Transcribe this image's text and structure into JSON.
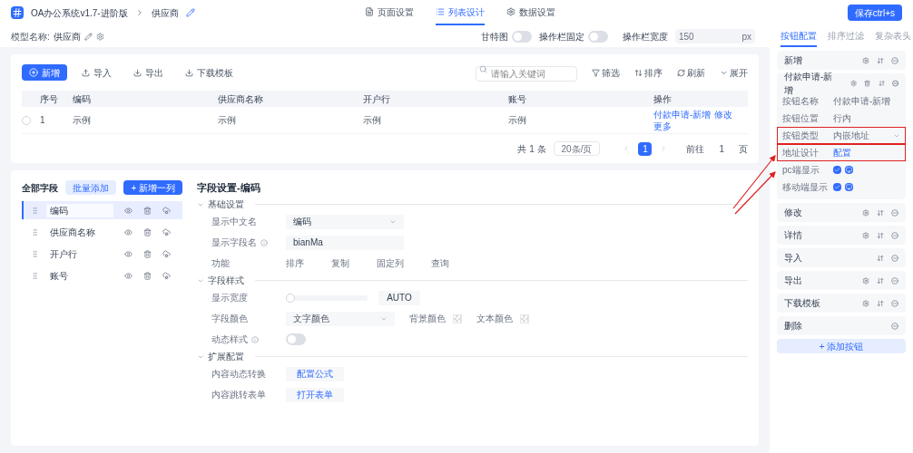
{
  "header": {
    "app": "OA办公系统v1.7-进阶版",
    "page": "供应商",
    "tabs": [
      {
        "label": "页面设置",
        "selected": false
      },
      {
        "label": "列表设计",
        "selected": true
      },
      {
        "label": "数据设置",
        "selected": false
      }
    ],
    "save_button": "保存ctrl+s"
  },
  "model": {
    "label": "模型名称:",
    "value": "供应商"
  },
  "list_options": {
    "toggles": [
      {
        "label": "甘特图",
        "on": false
      },
      {
        "label": "操作栏固定",
        "on": false
      }
    ],
    "width_label": "操作栏宽度",
    "width_value": "150",
    "width_unit": "px"
  },
  "side_tabs": [
    {
      "label": "按钮配置",
      "selected": true
    },
    {
      "label": "排序过滤",
      "selected": false
    },
    {
      "label": "复杂表头",
      "selected": false
    }
  ],
  "toolbar": {
    "buttons": [
      {
        "label": "新增",
        "kind": "primary"
      },
      {
        "label": "导入",
        "kind": "plain"
      },
      {
        "label": "导出",
        "kind": "plain"
      },
      {
        "label": "下载模板",
        "kind": "plain"
      }
    ],
    "search": {
      "placeholder": "请输入关键词"
    },
    "tools": [
      {
        "label": "筛选",
        "kind": "filter"
      },
      {
        "label": "排序",
        "kind": "sort"
      },
      {
        "label": "刷新",
        "kind": "refresh"
      },
      {
        "label": "展开",
        "kind": "expand"
      }
    ]
  },
  "table": {
    "columns": [
      "序号",
      "编码",
      "供应商名称",
      "开户行",
      "账号",
      "操作"
    ],
    "rows": [
      {
        "selected": false,
        "cells": [
          "1",
          "示例",
          "示例",
          "示例",
          "示例"
        ],
        "actions": [
          "付款申请-新增",
          "修改",
          "更多"
        ]
      }
    ]
  },
  "pagination": {
    "total": "共 1 条",
    "page_size": "20条/页",
    "pages": [
      {
        "label": "1",
        "selected": true
      }
    ],
    "goto_label": "前往",
    "goto_value": "1",
    "goto_suffix": "页"
  },
  "fields": {
    "title": "全部字段",
    "batch_button": "批量添加",
    "add_button": "+ 新增一列",
    "items": [
      {
        "name": "编码",
        "selected": true
      },
      {
        "name": "供应商名称",
        "selected": false
      },
      {
        "name": "开户行",
        "selected": false
      },
      {
        "name": "账号",
        "selected": false
      }
    ]
  },
  "settings": {
    "title": "字段设置-编码",
    "sections": [
      {
        "title": "基础设置",
        "expanded": true,
        "rows": [
          {
            "kind": "select",
            "label": "显示中文名",
            "info": false,
            "value": "编码"
          },
          {
            "kind": "input",
            "label": "显示字段名",
            "info": true,
            "value": "bianMa"
          },
          {
            "kind": "options",
            "label": "功能",
            "info": false,
            "options": [
              "排序",
              "复制",
              "固定列",
              "查询"
            ]
          }
        ]
      },
      {
        "title": "字段样式",
        "expanded": true,
        "rows": [
          {
            "kind": "slider",
            "label": "显示宽度",
            "info": false,
            "level": 0,
            "value": "AUTO"
          },
          {
            "kind": "color",
            "label": "字段颜色",
            "info": false,
            "value": "文字颜色",
            "swatches": [
              "背景颜色",
              "文本颜色"
            ]
          },
          {
            "kind": "toggle",
            "label": "动态样式",
            "info": true,
            "on": false
          }
        ]
      },
      {
        "title": "扩展配置",
        "expanded": true,
        "rows": [
          {
            "kind": "button",
            "label": "内容动态转换",
            "info": false,
            "value": "配置公式"
          },
          {
            "kind": "button",
            "label": "内容跳转表单",
            "info": false,
            "value": "打开表单"
          }
        ]
      }
    ]
  },
  "button_config": {
    "items": [
      {
        "name": "新增",
        "expanded": false,
        "settings": true,
        "deletable": false,
        "reorder": true
      },
      {
        "name": "付款申请-新增",
        "expanded": true,
        "settings": true,
        "deletable": true,
        "reorder": true,
        "props": [
          {
            "kind": "text",
            "label": "按钮名称",
            "value": "付款申请-新增",
            "highlighted": false
          },
          {
            "kind": "text",
            "label": "按钮位置",
            "value": "行内",
            "highlighted": false
          },
          {
            "kind": "select",
            "label": "按钮类型",
            "value": "内嵌地址",
            "highlighted": true
          },
          {
            "kind": "link",
            "label": "地址设计",
            "value": "配置",
            "highlighted": true
          },
          {
            "kind": "checkbox",
            "label": "pc端显示",
            "checked": true,
            "highlighted": false
          },
          {
            "kind": "checkbox",
            "label": "移动端显示",
            "checked": true,
            "highlighted": false
          }
        ]
      },
      {
        "name": "修改",
        "expanded": false,
        "settings": true,
        "deletable": false,
        "reorder": true
      },
      {
        "name": "详情",
        "expanded": false,
        "settings": true,
        "deletable": false,
        "reorder": true
      },
      {
        "name": "导入",
        "expanded": false,
        "settings": false,
        "deletable": false,
        "reorder": true
      },
      {
        "name": "导出",
        "expanded": false,
        "settings": true,
        "deletable": false,
        "reorder": true
      },
      {
        "name": "下载模板",
        "expanded": false,
        "settings": true,
        "deletable": false,
        "reorder": true
      },
      {
        "name": "删除",
        "expanded": false,
        "settings": false,
        "deletable": false,
        "reorder": false
      }
    ],
    "add_button": "+ 添加按钮"
  }
}
